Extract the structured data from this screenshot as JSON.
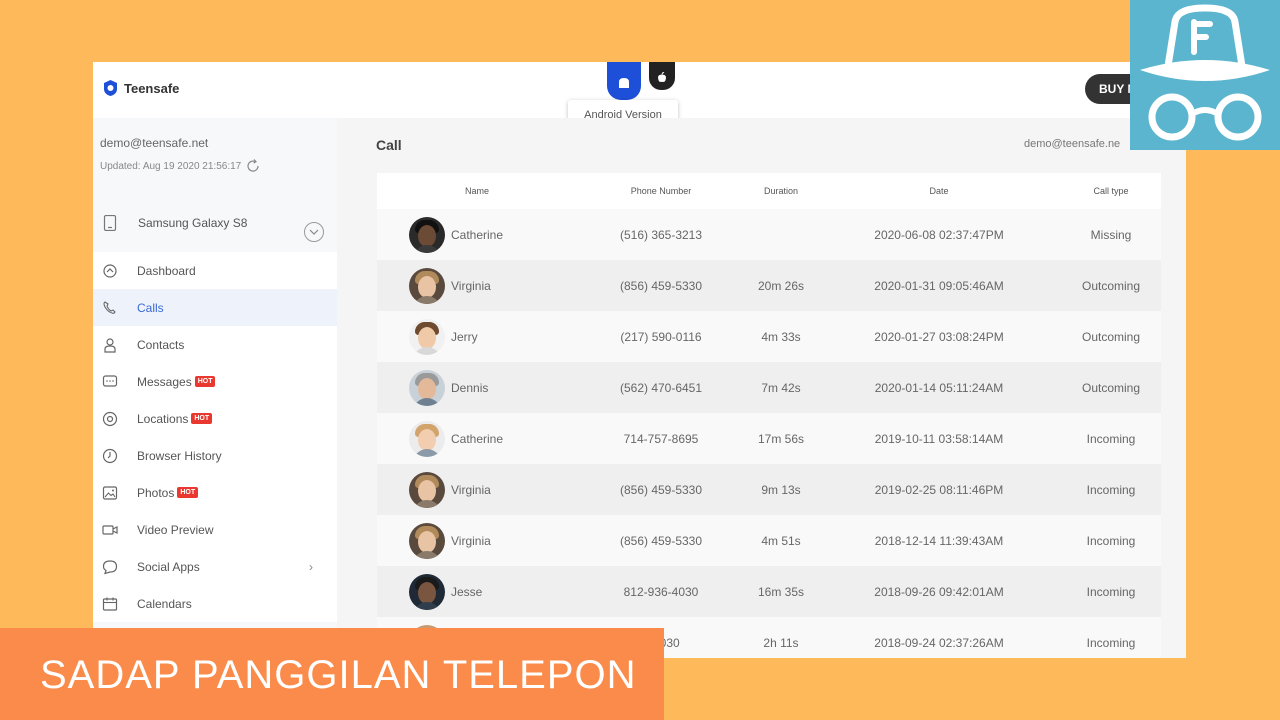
{
  "brand": {
    "name": "Teensafe"
  },
  "os_tabs": {
    "android_tooltip": "Android Version"
  },
  "header": {
    "buy_label": "BUY N"
  },
  "account": {
    "email": "demo@teensafe.net",
    "updated": "Updated: Aug 19 2020 21:56:17"
  },
  "device": {
    "name": "Samsung Galaxy S8"
  },
  "menu": {
    "items": [
      {
        "label": "Dashboard",
        "icon": "dashboard-icon"
      },
      {
        "label": "Calls",
        "icon": "phone-icon"
      },
      {
        "label": "Contacts",
        "icon": "person-icon"
      },
      {
        "label": "Messages",
        "icon": "message-icon",
        "badge": "HOT"
      },
      {
        "label": "Locations",
        "icon": "location-icon",
        "badge": "HOT"
      },
      {
        "label": "Browser History",
        "icon": "clock-icon"
      },
      {
        "label": "Photos",
        "icon": "image-icon",
        "badge": "HOT"
      },
      {
        "label": "Video Preview",
        "icon": "video-icon"
      },
      {
        "label": "Social Apps",
        "icon": "chat-bubble-icon"
      },
      {
        "label": "Calendars",
        "icon": "calendar-icon"
      }
    ]
  },
  "main": {
    "title": "Call",
    "email": "demo@teensafe.ne",
    "columns": [
      "Name",
      "Phone Number",
      "Duration",
      "Date",
      "Call type"
    ],
    "rows": [
      {
        "name": "Catherine",
        "phone": "(516) 365-3213",
        "duration": "",
        "date": "2020-06-08 02:37:47PM",
        "type": "Missing"
      },
      {
        "name": "Virginia",
        "phone": "(856) 459-5330",
        "duration": "20m 26s",
        "date": "2020-01-31 09:05:46AM",
        "type": "Outcoming"
      },
      {
        "name": "Jerry",
        "phone": "(217) 590-0116",
        "duration": "4m 33s",
        "date": "2020-01-27 03:08:24PM",
        "type": "Outcoming"
      },
      {
        "name": "Dennis",
        "phone": "(562) 470-6451",
        "duration": "7m 42s",
        "date": "2020-01-14 05:11:24AM",
        "type": "Outcoming"
      },
      {
        "name": "Catherine",
        "phone": "714-757-8695",
        "duration": "17m 56s",
        "date": "2019-10-11 03:58:14AM",
        "type": "Incoming"
      },
      {
        "name": "Virginia",
        "phone": "(856) 459-5330",
        "duration": "9m 13s",
        "date": "2019-02-25 08:11:46PM",
        "type": "Incoming"
      },
      {
        "name": "Virginia",
        "phone": "(856) 459-5330",
        "duration": "4m 51s",
        "date": "2018-12-14 11:39:43AM",
        "type": "Incoming"
      },
      {
        "name": "Jesse",
        "phone": "812-936-4030",
        "duration": "16m 35s",
        "date": "2018-09-26 09:42:01AM",
        "type": "Incoming"
      },
      {
        "name": "",
        "phone": "3-4030",
        "duration": "2h 11s",
        "date": "2018-09-24 02:37:26AM",
        "type": "Incoming"
      }
    ]
  },
  "banner": {
    "text": "SADAP PANGGILAN TELEPON"
  },
  "colors": {
    "accent": "#1e4fd8",
    "banner": "#fa8b4a",
    "background": "#fdb95a",
    "spy_box": "#5bb5cf",
    "hot_badge": "#e8382f"
  }
}
